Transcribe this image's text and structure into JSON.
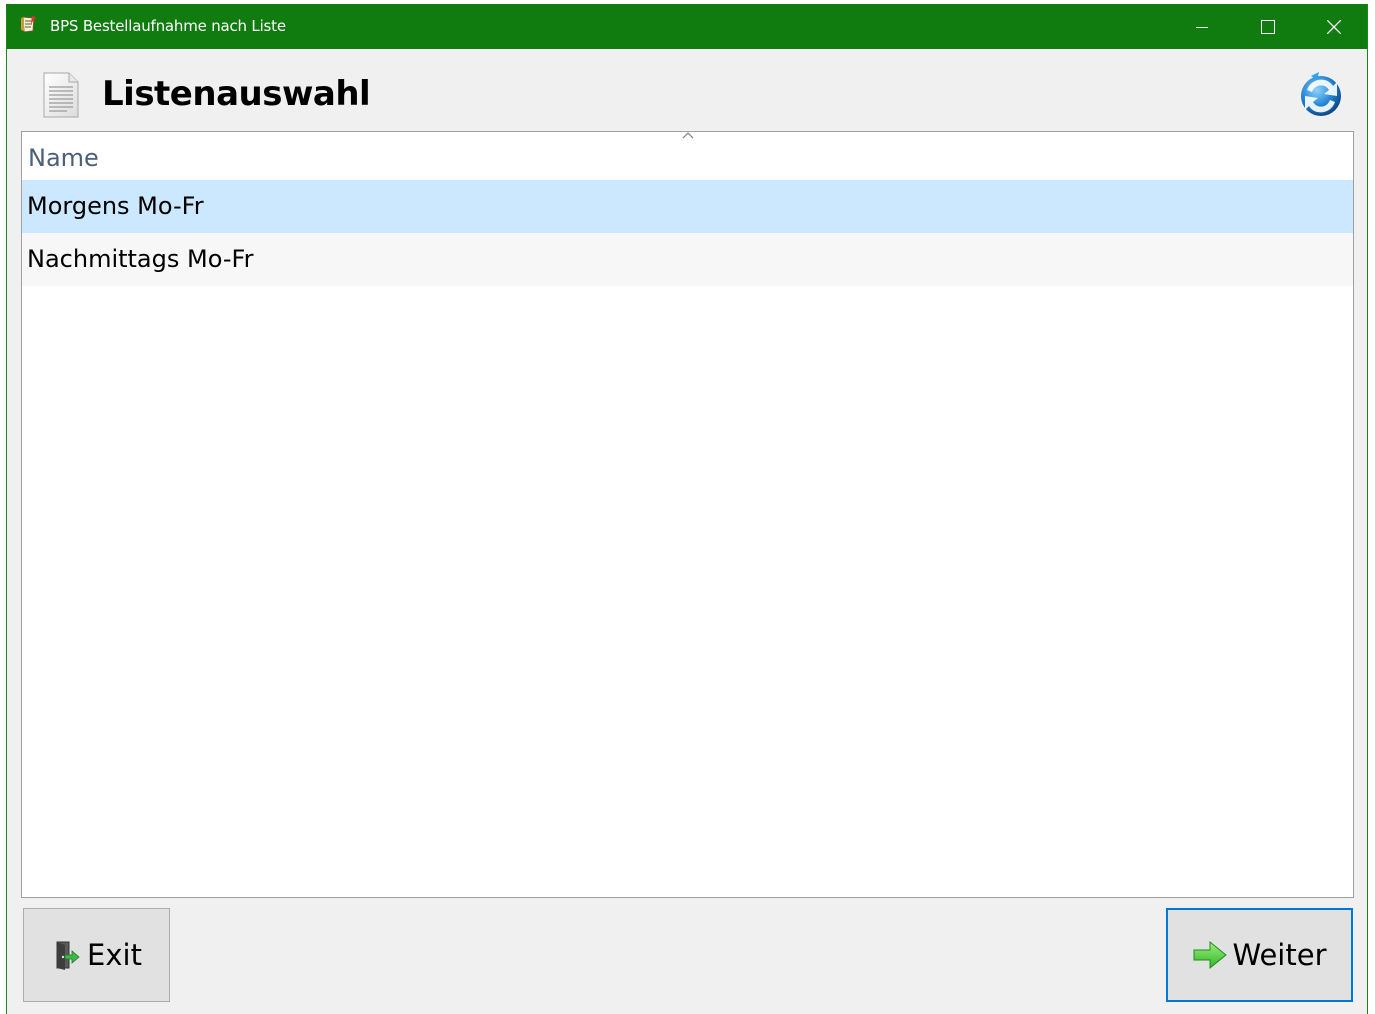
{
  "window": {
    "title": "BPS Bestellaufnahme nach Liste",
    "accent_color": "#107c10"
  },
  "header": {
    "title": "Listenauswahl",
    "icon": "document-icon",
    "refresh_icon": "refresh-icon"
  },
  "list": {
    "columns": [
      "Name"
    ],
    "sort_indicator": "sort-ascending-icon",
    "rows": [
      {
        "name": "Morgens Mo-Fr",
        "selected": true
      },
      {
        "name": "Nachmittags Mo-Fr",
        "selected": false
      }
    ],
    "selection_color": "#cce8ff"
  },
  "footer": {
    "exit_label": "Exit",
    "exit_icon": "door-exit-icon",
    "next_label": "Weiter",
    "next_icon": "arrow-right-icon",
    "focus_color": "#0078d7"
  }
}
